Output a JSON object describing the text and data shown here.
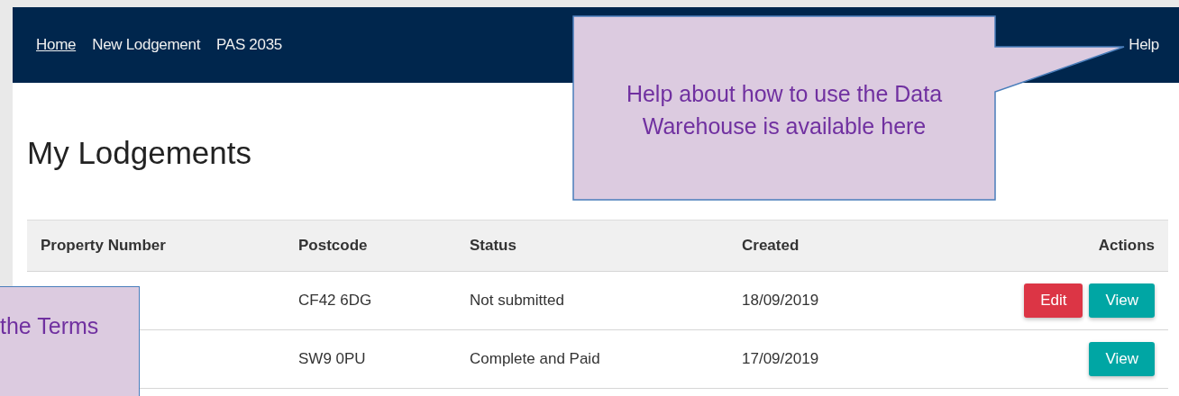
{
  "nav": {
    "links": [
      {
        "label": "Home",
        "selected": true
      },
      {
        "label": "New Lodgement",
        "selected": false
      },
      {
        "label": "PAS 2035",
        "selected": false
      }
    ],
    "help": "Help"
  },
  "page_title": "My Lodgements",
  "table": {
    "columns": [
      "Property Number",
      "Postcode",
      "Status",
      "Created",
      "Actions"
    ],
    "rows": [
      {
        "postcode": "CF42 6DG",
        "status": "Not submitted",
        "created": "18/09/2019",
        "actions": [
          {
            "kind": "edit",
            "label": "Edit"
          },
          {
            "kind": "view",
            "label": "View"
          }
        ]
      },
      {
        "postcode": "SW9 0PU",
        "status": "Complete and Paid",
        "created": "17/09/2019",
        "actions": [
          {
            "kind": "view",
            "label": "View"
          }
        ]
      }
    ]
  },
  "callouts": [
    {
      "text": "Help about how to use the Data Warehouse is available here"
    },
    {
      "text": "the Terms"
    }
  ]
}
